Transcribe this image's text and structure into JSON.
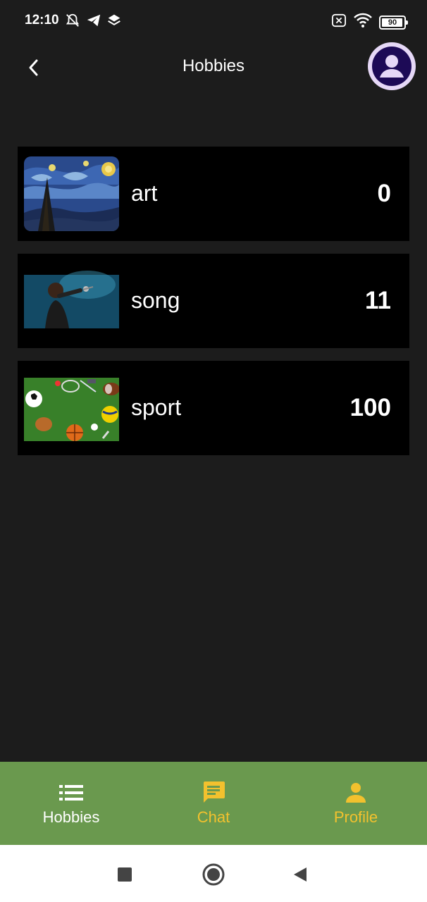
{
  "status_bar": {
    "time": "12:10",
    "battery": "90",
    "icons_left": [
      "alarm-off-icon",
      "telegram-icon",
      "layers-icon"
    ],
    "icons_right": [
      "sim-off-icon",
      "wifi-icon",
      "battery-icon"
    ]
  },
  "app_bar": {
    "title": "Hobbies",
    "back_icon": "chevron-left-icon",
    "avatar_icon": "account-circle-icon"
  },
  "hobbies": [
    {
      "label": "art",
      "count": "0",
      "thumbnail": "starry-night-painting"
    },
    {
      "label": "song",
      "count": "11",
      "thumbnail": "singer-with-microphone"
    },
    {
      "label": "sport",
      "count": "100",
      "thumbnail": "sports-balls-on-grass"
    }
  ],
  "bottom_nav": {
    "items": [
      {
        "label": "Hobbies",
        "icon": "list-icon",
        "active": true
      },
      {
        "label": "Chat",
        "icon": "chat-icon",
        "active": false
      },
      {
        "label": "Profile",
        "icon": "person-icon",
        "active": false
      }
    ]
  },
  "colors": {
    "background": "#1c1c1c",
    "card": "#000000",
    "nav_background": "#6a994e",
    "nav_inactive": "#f2c12e",
    "nav_active": "#ffffff",
    "avatar_ring": "#e6d8f7",
    "avatar_fill": "#1d0a56"
  },
  "system_nav": [
    "recents-square-icon",
    "home-circle-icon",
    "back-triangle-icon"
  ]
}
